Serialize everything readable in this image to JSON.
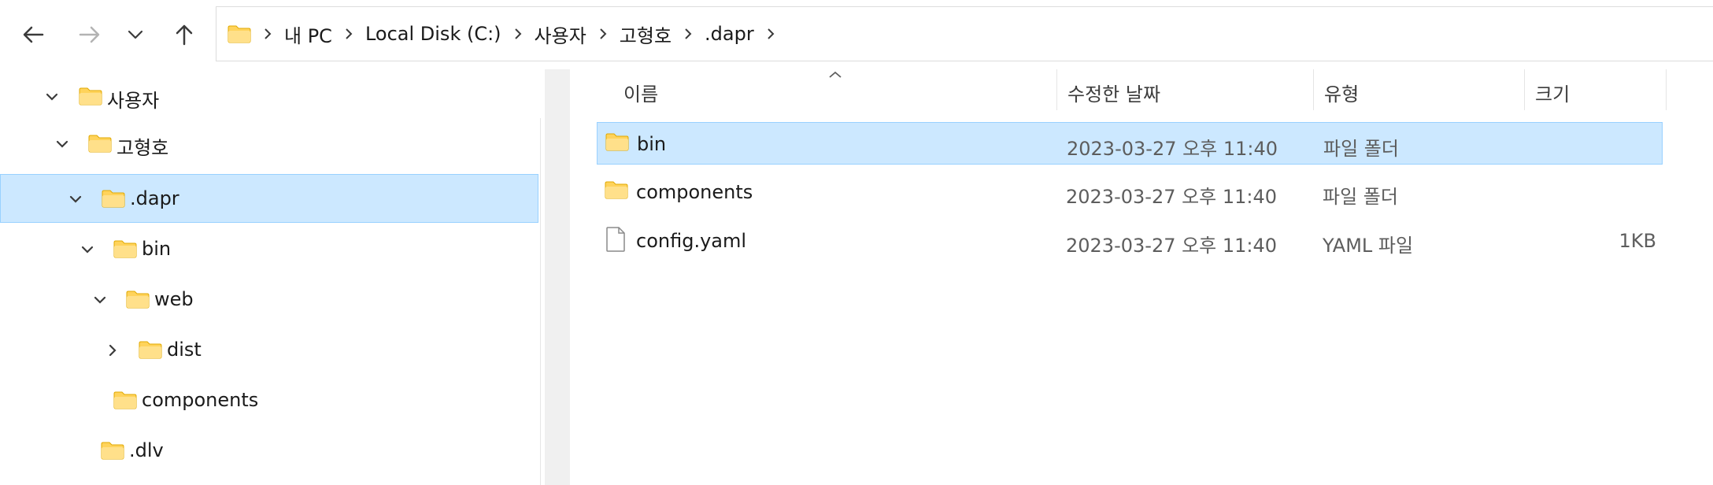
{
  "toolbar": {
    "back_icon": "arrow-left-icon",
    "forward_icon": "arrow-right-icon",
    "recent_icon": "chevron-down-icon",
    "up_icon": "arrow-up-icon"
  },
  "breadcrumb": {
    "items": [
      "내 PC",
      "Local Disk (C:)",
      "사용자",
      "고형호",
      ".dapr"
    ]
  },
  "navigation_tree": [
    {
      "label": "사용자",
      "expanded": true
    },
    {
      "label": "고형호",
      "expanded": true
    },
    {
      "label": ".dapr",
      "expanded": true,
      "selected": true
    },
    {
      "label": "bin",
      "expanded": true
    },
    {
      "label": "web",
      "expanded": true
    },
    {
      "label": "dist",
      "expanded": false
    },
    {
      "label": "components"
    },
    {
      "label": ".dlv"
    }
  ],
  "columns": {
    "name": "이름",
    "date": "수정한 날짜",
    "type": "유형",
    "size": "크기"
  },
  "files": [
    {
      "name": "bin",
      "date": "2023-03-27 오후 11:40",
      "type": "파일 폴더",
      "size": "",
      "icon": "folder-icon",
      "selected": true
    },
    {
      "name": "components",
      "date": "2023-03-27 오후 11:40",
      "type": "파일 폴더",
      "size": "",
      "icon": "folder-icon"
    },
    {
      "name": "config.yaml",
      "date": "2023-03-27 오후 11:40",
      "type": "YAML 파일",
      "size": "1KB",
      "icon": "file-icon"
    }
  ],
  "colors": {
    "selection_bg": "#cce8ff",
    "selection_border": "#99d1ff",
    "folder_yellow": "#ffd35b"
  }
}
